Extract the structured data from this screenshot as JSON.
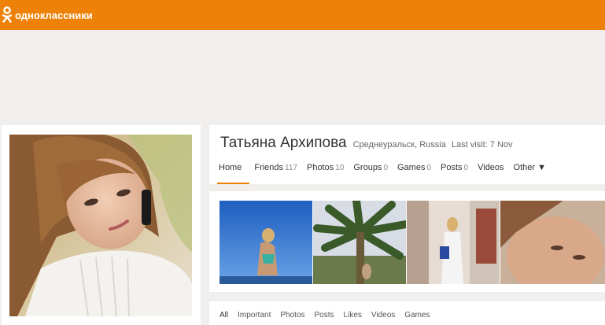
{
  "app": {
    "brand": "одноклассники",
    "brand_color": "#ee8208"
  },
  "profile": {
    "name": "Татьяна Архипова",
    "location": "Среднеуральск, Russia",
    "last_visit": "Last visit: 7 Nov"
  },
  "nav": [
    {
      "label": "Home",
      "count": ""
    },
    {
      "label": "Friends",
      "count": "117"
    },
    {
      "label": "Photos",
      "count": "10"
    },
    {
      "label": "Groups",
      "count": "0"
    },
    {
      "label": "Games",
      "count": "0"
    },
    {
      "label": "Posts",
      "count": "0"
    },
    {
      "label": "Videos",
      "count": ""
    },
    {
      "label": "Other ▼",
      "count": ""
    }
  ],
  "feed_tabs": [
    "All",
    "Important",
    "Photos",
    "Posts",
    "Likes",
    "Videos",
    "Games"
  ]
}
